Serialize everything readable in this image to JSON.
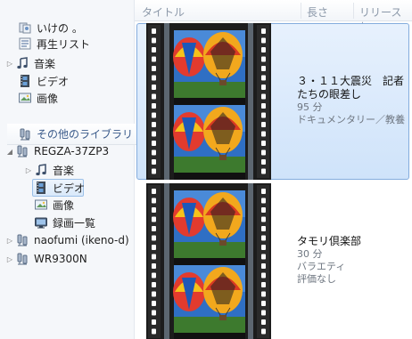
{
  "sidebar": {
    "items": [
      {
        "label": "いけの 。",
        "icon": "library-user-icon"
      },
      {
        "label": "再生リスト",
        "icon": "playlist-icon"
      },
      {
        "label": "音楽",
        "icon": "music-note-icon"
      },
      {
        "label": "ビデオ",
        "icon": "video-film-icon"
      },
      {
        "label": "画像",
        "icon": "picture-icon"
      },
      {
        "label": "その他のライブラリ",
        "icon": "network-library-icon"
      },
      {
        "label": "REGZA-37ZP3",
        "icon": "network-device-icon"
      },
      {
        "label": "音楽",
        "icon": "music-note-icon"
      },
      {
        "label": "ビデオ",
        "icon": "video-film-icon"
      },
      {
        "label": "画像",
        "icon": "picture-icon"
      },
      {
        "label": "録画一覧",
        "icon": "tv-recording-icon"
      },
      {
        "label": "naofumi (ikeno-d)",
        "icon": "network-device-icon"
      },
      {
        "label": "WR9300N",
        "icon": "network-device-icon"
      }
    ]
  },
  "columns": {
    "title": "タイトル",
    "length": "長さ",
    "year": "リリース年"
  },
  "items": [
    {
      "title": "３・１１大震災　記者たちの眼差し",
      "duration": "95 分",
      "genre": "ドキュメンタリー／教養",
      "rating": ""
    },
    {
      "title": "タモリ倶楽部",
      "duration": "30 分",
      "genre": "バラエティ",
      "rating": "評価なし"
    }
  ],
  "colors": {
    "selection_border": "#84acdd",
    "selection_fill": "#d9e9fa",
    "sidebar_bg": "#f5f7fa",
    "header_text": "#8a97a8"
  }
}
